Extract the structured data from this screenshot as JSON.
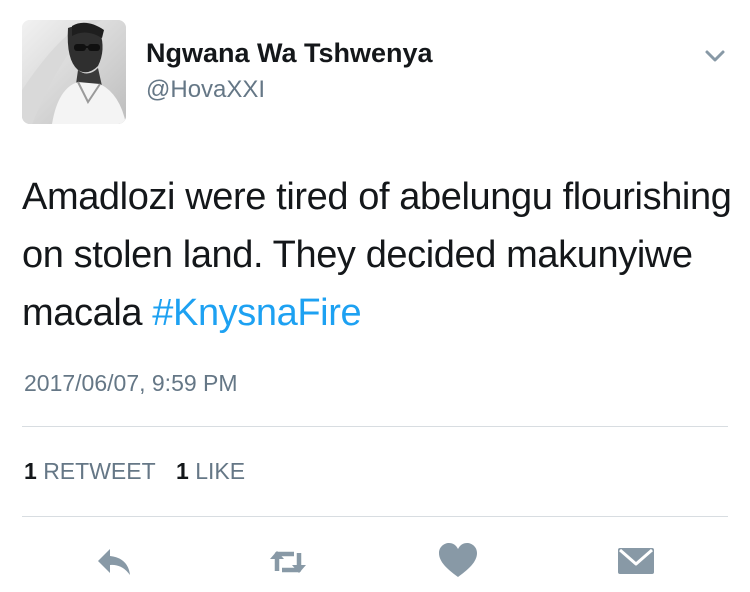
{
  "user": {
    "display_name": "Ngwana Wa Tshwenya",
    "handle": "@HovaXXI"
  },
  "tweet": {
    "text": "Amadlozi were tired of abelungu flourishing on stolen land. They decided makunyiwe macala ",
    "hashtag": "#KnysnaFire",
    "timestamp": "2017/06/07, 9:59 PM"
  },
  "stats": {
    "retweets_count": "1",
    "retweets_label": "RETWEET",
    "likes_count": "1",
    "likes_label": "LIKE"
  },
  "icons": {
    "menu": "chevron-down-icon",
    "reply": "reply-icon",
    "retweet": "retweet-icon",
    "like": "heart-icon",
    "message": "envelope-icon"
  },
  "colors": {
    "link": "#1da1f2",
    "secondary_text": "#657786",
    "icon": "#8899a6",
    "divider": "#d8dde1"
  }
}
